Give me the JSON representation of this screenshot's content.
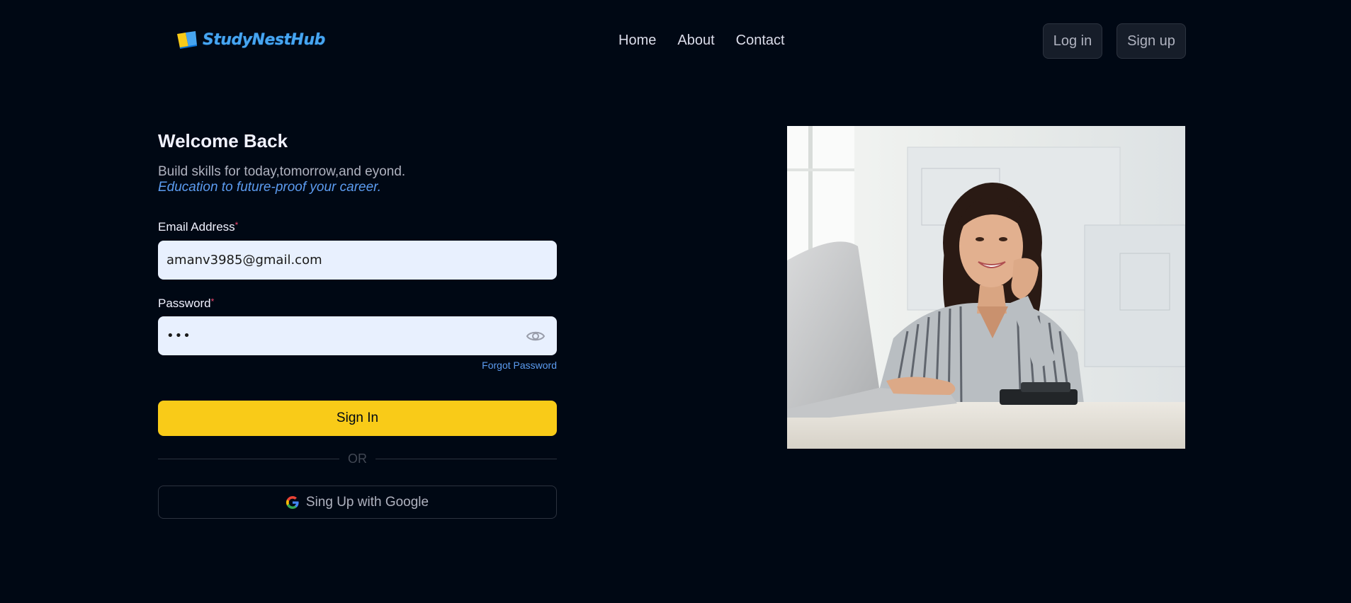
{
  "header": {
    "logo_text": "StudyNestHub",
    "nav_links": [
      {
        "label": "Home"
      },
      {
        "label": "About"
      },
      {
        "label": "Contact"
      }
    ],
    "login_label": "Log in",
    "signup_label": "Sign up"
  },
  "form": {
    "title": "Welcome Back",
    "subtitle": "Build skills for today,tomorrow,and eyond.",
    "tagline": "Education to future-proof your career.",
    "email_label": "Email Address",
    "email_value": "amanv3985@gmail.com",
    "required_mark": "*",
    "password_label": "Password",
    "password_value": "•••",
    "forgot_label": "Forgot Password",
    "signin_label": "Sign In",
    "or_label": "OR",
    "google_label": "Sing Up with Google"
  },
  "colors": {
    "background": "#000814",
    "accent_yellow": "#f9cb18",
    "link_blue": "#5c9cf0",
    "input_bg": "#e8f0fe"
  },
  "icons": {
    "eye": "eye-icon",
    "google": "google-icon",
    "logo": "book-icon"
  }
}
